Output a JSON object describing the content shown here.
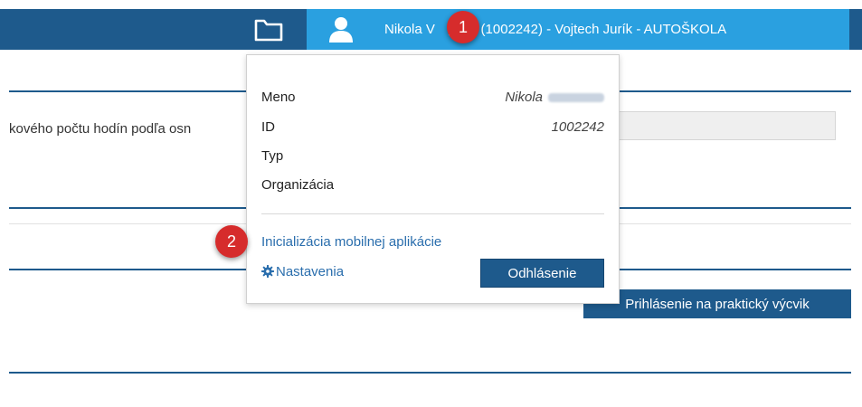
{
  "topbar": {
    "user_name": "Nikola V",
    "user_name_rest": "gová (1002242) - Vojtech Jurík - AUTOŠKOLA",
    "colors": {
      "bar": "#1e5a8c",
      "active": "#2aa0e0"
    }
  },
  "background": {
    "text": "kového počtu hodín podľa osn",
    "button": "Prihlásenie na praktický výcvik"
  },
  "dropdown": {
    "rows": [
      {
        "label": "Meno",
        "value": "Nikola"
      },
      {
        "label": "ID",
        "value": "1002242"
      },
      {
        "label": "Typ",
        "value": ""
      },
      {
        "label": "Organizácia",
        "value": ""
      }
    ],
    "init_link": "Inicializácia mobilnej aplikácie",
    "settings_link": "Nastavenia",
    "logout_button": "Odhlásenie"
  },
  "markers": [
    "1",
    "2"
  ]
}
